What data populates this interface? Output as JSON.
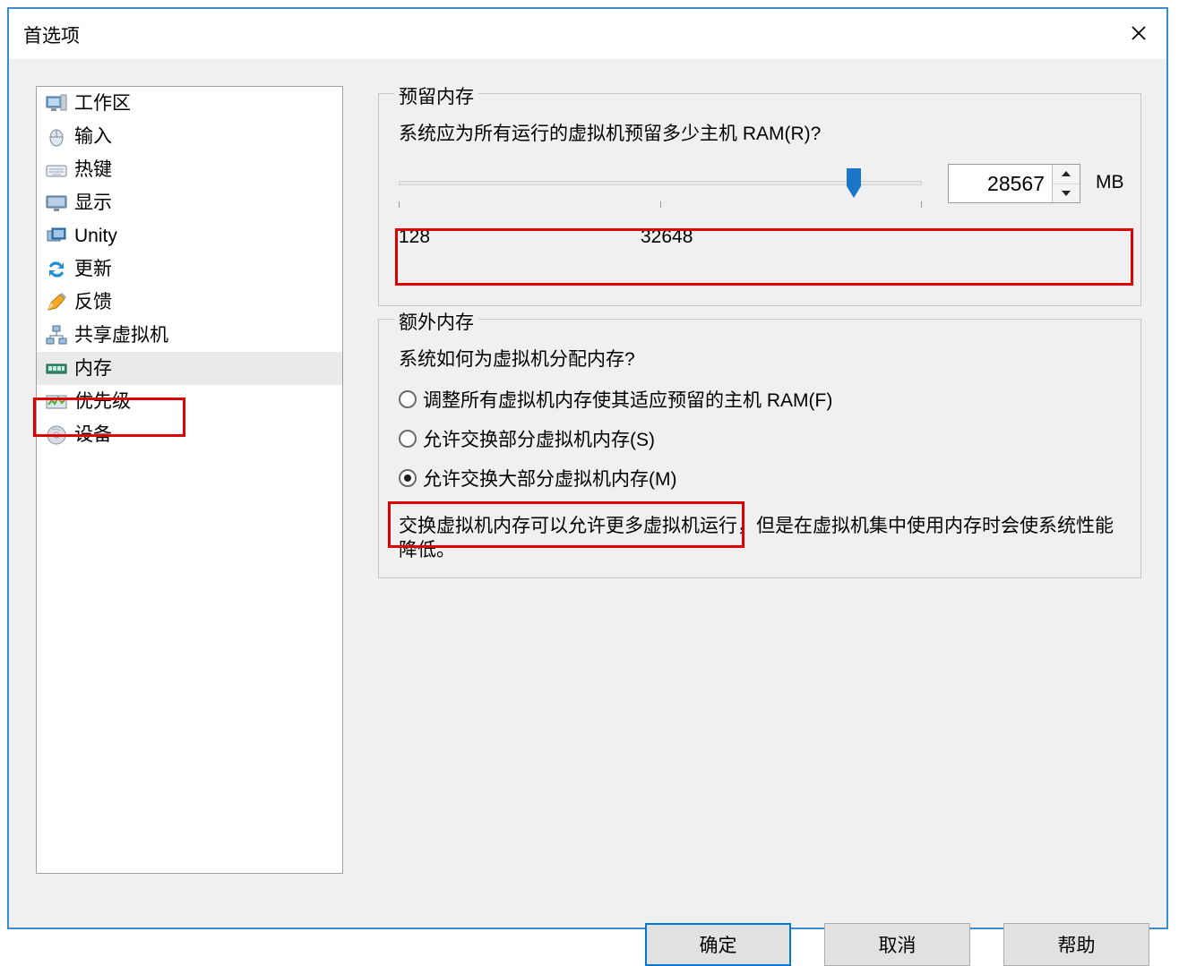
{
  "window": {
    "title": "首选项",
    "close_icon": "close-icon"
  },
  "sidebar": {
    "items": [
      {
        "label": "工作区",
        "icon": "workspace-icon",
        "selected": false
      },
      {
        "label": "输入",
        "icon": "mouse-icon",
        "selected": false
      },
      {
        "label": "热键",
        "icon": "keyboard-icon",
        "selected": false
      },
      {
        "label": "显示",
        "icon": "display-icon",
        "selected": false
      },
      {
        "label": "Unity",
        "icon": "unity-icon",
        "selected": false
      },
      {
        "label": "更新",
        "icon": "update-icon",
        "selected": false
      },
      {
        "label": "反馈",
        "icon": "feedback-icon",
        "selected": false
      },
      {
        "label": "共享虚拟机",
        "icon": "shared-vm-icon",
        "selected": false
      },
      {
        "label": "内存",
        "icon": "memory-icon",
        "selected": true
      },
      {
        "label": "优先级",
        "icon": "priority-icon",
        "selected": false
      },
      {
        "label": "设备",
        "icon": "device-icon",
        "selected": false
      }
    ]
  },
  "reserved_memory": {
    "legend": "预留内存",
    "question": "系统应为所有运行的虚拟机预留多少主机 RAM(R)?",
    "slider": {
      "value": 28567,
      "min": 128,
      "max": 32648,
      "min_label": "128",
      "max_label": "32648",
      "thumb_percent": 87
    },
    "spin_value": "28567",
    "unit": "MB",
    "spin_up_icon": "caret-up-icon",
    "spin_down_icon": "caret-down-icon"
  },
  "extra_memory": {
    "legend": "额外内存",
    "question": "系统如何为虚拟机分配内存?",
    "options": [
      {
        "label": "调整所有虚拟机内存使其适应预留的主机 RAM(F)",
        "checked": false
      },
      {
        "label": "允许交换部分虚拟机内存(S)",
        "checked": false
      },
      {
        "label": "允许交换大部分虚拟机内存(M)",
        "checked": true
      }
    ],
    "description": "交换虚拟机内存可以允许更多虚拟机运行，但是在虚拟机集中使用内存时会使系统性能降低。"
  },
  "buttons": {
    "ok": "确定",
    "cancel": "取消",
    "help": "帮助"
  },
  "annotations": {
    "accent_color": "#e00000",
    "count": 3
  }
}
